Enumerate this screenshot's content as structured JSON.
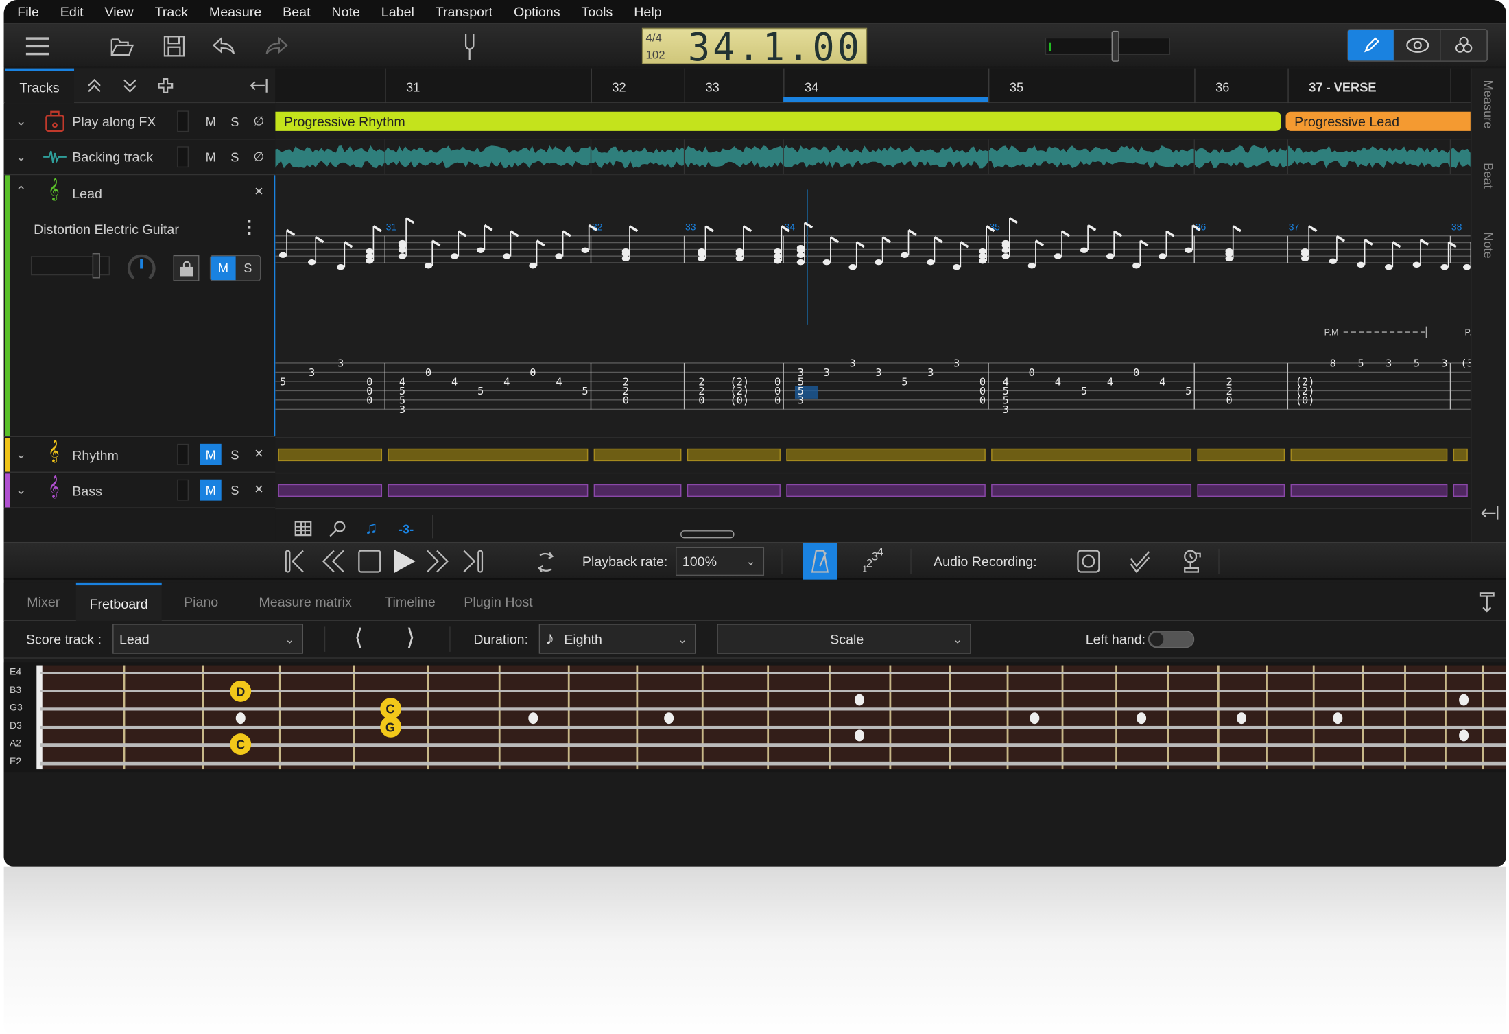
{
  "menu": [
    "File",
    "Edit",
    "View",
    "Track",
    "Measure",
    "Beat",
    "Note",
    "Label",
    "Transport",
    "Options",
    "Tools",
    "Help"
  ],
  "lcd": {
    "time_signature": "4/4",
    "tempo": "102",
    "position": "34.1.00"
  },
  "volume_level": 0.55,
  "tracks_tab": "Tracks",
  "ruler": {
    "measures": [
      "31",
      "32",
      "33",
      "34",
      "35",
      "36",
      "37 - VERSE"
    ],
    "selected": "34"
  },
  "sections": [
    {
      "label": "Progressive Rhythm",
      "color": "#c4e31c"
    },
    {
      "label": "Progressive Lead",
      "color": "#f49a31"
    }
  ],
  "tracks": [
    {
      "name": "Play along FX",
      "mute": "M",
      "solo": "S",
      "color": "#c0392b"
    },
    {
      "name": "Backing track",
      "mute": "M",
      "solo": "S",
      "color": "#2f9e9a"
    },
    {
      "name": "Lead",
      "instrument": "Distortion Electric Guitar",
      "mute": "M",
      "solo": "S",
      "color": "#5ac02a",
      "muted": true
    },
    {
      "name": "Rhythm",
      "mute": "M",
      "solo": "S",
      "color": "#f0c419",
      "muted": true
    },
    {
      "name": "Bass",
      "mute": "M",
      "solo": "S",
      "color": "#b050d0",
      "muted": true
    }
  ],
  "score": {
    "measure_numbers": [
      "31",
      "32",
      "33",
      "34",
      "35",
      "36",
      "37",
      "38"
    ],
    "palm_mute": "P.M",
    "palm_mute_cut": "P.",
    "tab": [
      [
        {
          "3": "5"
        },
        {
          "2": "3"
        },
        {
          "1": "3"
        },
        {
          "3": "0",
          "4": "0",
          "5": "0"
        }
      ],
      [
        {
          "3": "4",
          "4": "5",
          "5": "5",
          "6": "3"
        },
        {
          "2": "0"
        },
        {
          "3": "4"
        },
        {
          "4": "5"
        },
        {
          "3": "4"
        },
        {
          "2": "0"
        },
        {
          "3": "4"
        },
        {
          "4": "5"
        }
      ],
      [
        {
          "3": "2",
          "4": "2",
          "5": "0"
        }
      ],
      [
        {
          "3": "2",
          "4": "2",
          "5": "0"
        },
        {
          "3": "(2)",
          "4": "(2)",
          "5": "(0)"
        },
        {
          "3": "0",
          "4": "0",
          "5": "0"
        }
      ],
      [
        {
          "2": "3",
          "3": "5",
          "4": "5",
          "5": "3"
        },
        {
          "2": "3"
        },
        {
          "1": "3"
        },
        {
          "2": "3"
        },
        {
          "3": "5"
        },
        {
          "2": "3"
        },
        {
          "1": "3"
        },
        {
          "3": "0",
          "4": "0",
          "5": "0"
        }
      ],
      [
        {
          "3": "4",
          "4": "5",
          "5": "5",
          "6": "3"
        },
        {
          "2": "0"
        },
        {
          "3": "4"
        },
        {
          "4": "5"
        },
        {
          "3": "4"
        },
        {
          "2": "0"
        },
        {
          "3": "4"
        },
        {
          "4": "5"
        }
      ],
      [
        {
          "3": "2",
          "4": "2",
          "5": "0"
        }
      ],
      [
        {
          "3": "(2)",
          "4": "(2)",
          "5": "(0)"
        },
        {
          "1": "8"
        },
        {
          "1": "5"
        },
        {
          "1": "3"
        },
        {
          "1": "5"
        },
        {
          "1": "3"
        }
      ],
      [
        {
          "1": "(3"
        }
      ]
    ]
  },
  "edit_tools": {
    "triplet": "-3-"
  },
  "transport": {
    "playback_rate_label": "Playback rate:",
    "playback_rate": "100%",
    "count_in": "1234",
    "audio_recording_label": "Audio Recording:"
  },
  "bottom_tabs": [
    "Mixer",
    "Fretboard",
    "Piano",
    "Measure matrix",
    "Timeline",
    "Plugin Host"
  ],
  "active_bottom_tab": "Fretboard",
  "fretboard_controls": {
    "score_track_label": "Score track :",
    "score_track": "Lead",
    "duration_label": "Duration:",
    "duration": "Eighth",
    "scale": "Scale",
    "left_hand_label": "Left hand:",
    "left_hand": false
  },
  "fretboard": {
    "strings": [
      "E4",
      "B3",
      "G3",
      "D3",
      "A2",
      "E2"
    ],
    "notes": [
      {
        "label": "D",
        "string": "B3",
        "fret": 3
      },
      {
        "label": "C",
        "string": "A2",
        "fret": 3
      },
      {
        "label": "C",
        "string": "G3",
        "fret": 5
      },
      {
        "label": "G",
        "string": "D3",
        "fret": 5
      }
    ]
  },
  "colors": {
    "accent": "#1a82e0",
    "note": "#f2c81a",
    "fretboard": "#331e19"
  }
}
